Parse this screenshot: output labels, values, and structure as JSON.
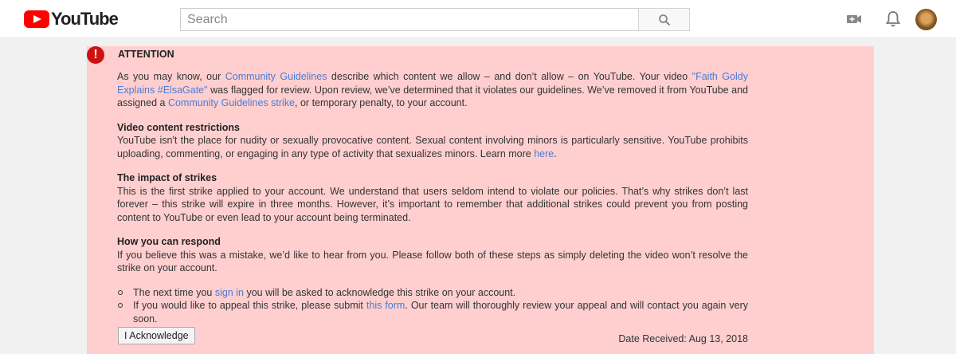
{
  "header": {
    "logo_text": "YouTube",
    "search_placeholder": "Search"
  },
  "icons": {
    "upload": "video-camera-plus-icon",
    "notifications": "bell-icon",
    "search": "magnifier-icon",
    "alert": "exclamation-icon"
  },
  "colors": {
    "alert_bg": "#ffcfcf",
    "alert_icon": "#cc1111",
    "link": "#4a7cd6",
    "brand_red": "#ff0000"
  },
  "notice": {
    "icon_glyph": "!",
    "title": "ATTENTION",
    "intro": {
      "t1": "As you may know, our ",
      "link1": "Community Guidelines",
      "t2": " describe which content we allow – and don’t allow – on YouTube. Your video ",
      "link2": "\"Faith Goldy Explains #ElsaGate\"",
      "t3": " was flagged for review. Upon review, we’ve determined that it violates our guidelines. We’ve removed it from YouTube and assigned a ",
      "link3": "Community Guidelines strike",
      "t4": ", or temporary penalty, to your account."
    },
    "restrictions": {
      "heading": "Video content restrictions",
      "text": "YouTube isn't the place for nudity or sexually provocative content. Sexual content involving minors is particularly sensitive. YouTube prohibits uploading, commenting, or engaging in any type of activity that sexualizes minors. Learn more ",
      "link": "here",
      "end": "."
    },
    "impact": {
      "heading": "The impact of strikes",
      "text": "This is the first strike applied to your account. We understand that users seldom intend to violate our policies. That’s why strikes don’t last forever – this strike will expire in three months. However, it’s important to remember that additional strikes could prevent you from posting content to YouTube or even lead to your account being terminated."
    },
    "respond": {
      "heading": "How you can respond",
      "text": "If you believe this was a mistake, we’d like to hear from you. Please follow both of these steps as simply deleting the video won’t resolve the strike on your account."
    },
    "steps": [
      {
        "before": "The next time you ",
        "link": "sign in",
        "after": " you will be asked to acknowledge this strike on your account."
      },
      {
        "before": "If you would like to appeal this strike, please submit ",
        "link": "this form",
        "after": ". Our team will thoroughly review your appeal and will contact you again very soon."
      }
    ],
    "ack_button": "I Acknowledge",
    "date_received": "Date Received: Aug 13, 2018"
  }
}
